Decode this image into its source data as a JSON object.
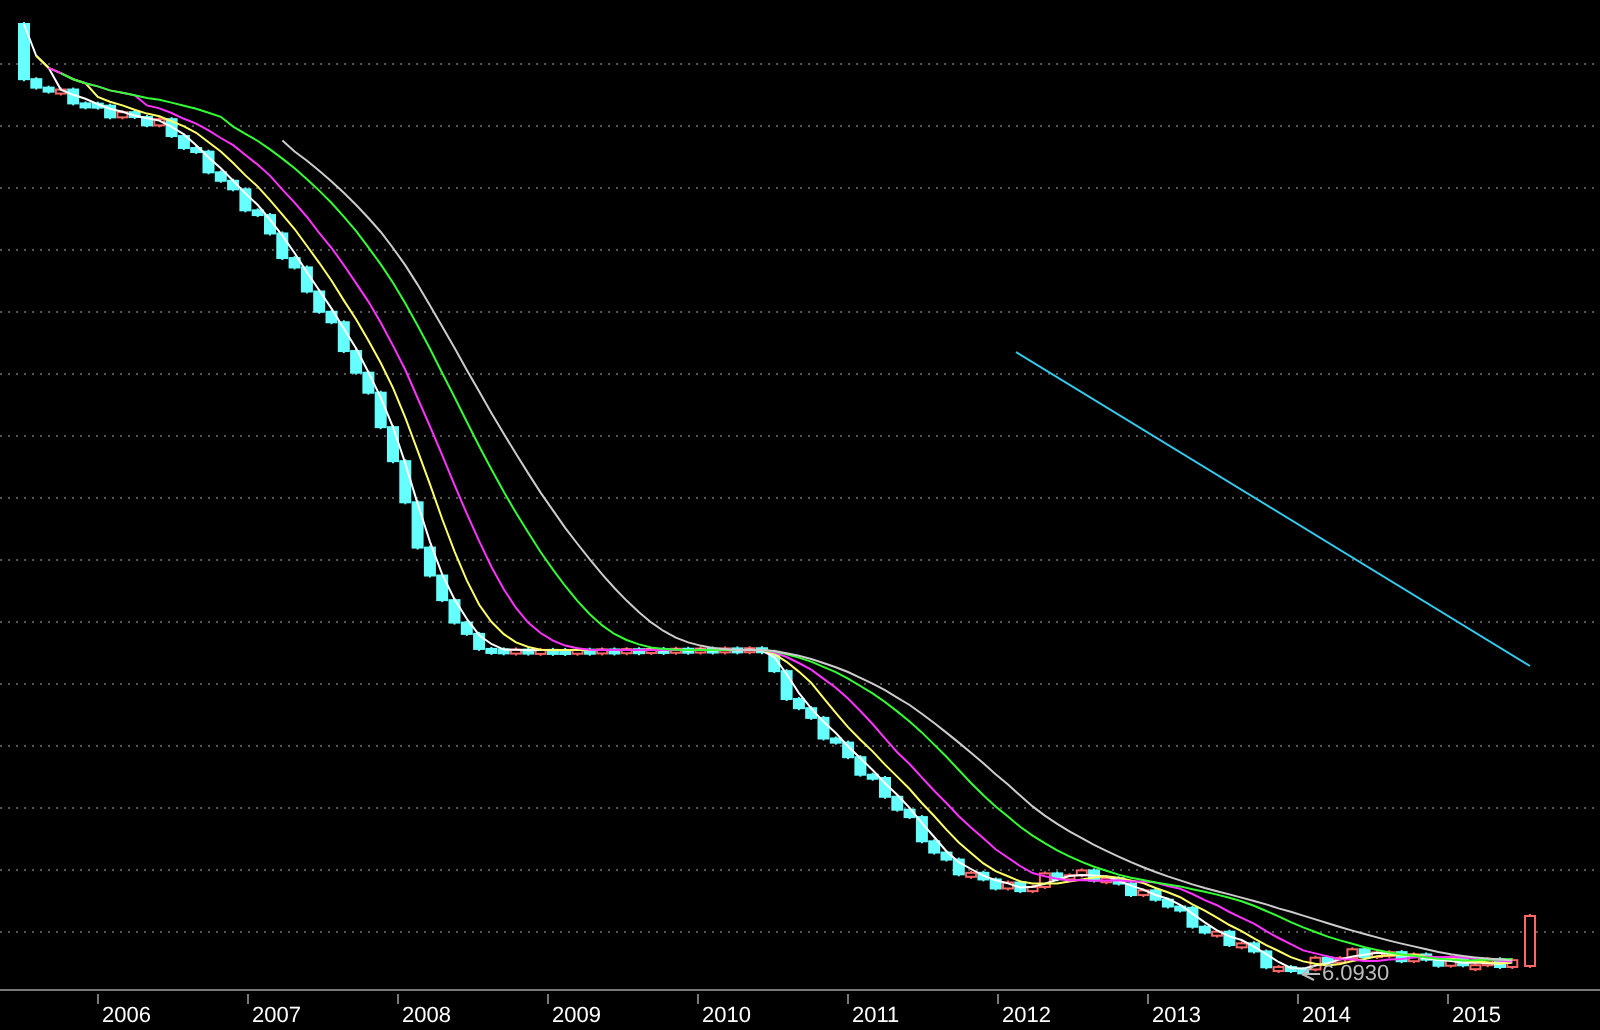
{
  "x_axis": {
    "labels": [
      "2006",
      "2007",
      "2008",
      "2009",
      "2010",
      "2011",
      "2012",
      "2013",
      "2014",
      "2015"
    ]
  },
  "low_marker": {
    "label": "6.0930"
  }
}
